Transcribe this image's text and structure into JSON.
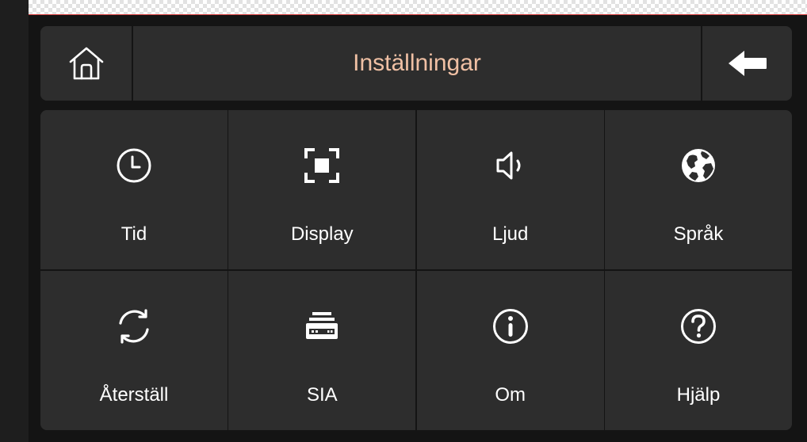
{
  "header": {
    "title": "Inställningar"
  },
  "icons": {
    "home": "home-icon",
    "back": "arrow-left-icon"
  },
  "tiles": [
    {
      "label": "Tid",
      "icon": "clock-icon"
    },
    {
      "label": "Display",
      "icon": "display-icon"
    },
    {
      "label": "Ljud",
      "icon": "speaker-icon"
    },
    {
      "label": "Språk",
      "icon": "globe-icon"
    },
    {
      "label": "Återställ",
      "icon": "reset-icon"
    },
    {
      "label": "SIA",
      "icon": "device-icon"
    },
    {
      "label": "Om",
      "icon": "info-icon"
    },
    {
      "label": "Hjälp",
      "icon": "help-icon"
    }
  ],
  "colors": {
    "title": "#f0c0a4",
    "panel": "#2d2d2d",
    "background": "#141414",
    "text": "#ffffff"
  }
}
